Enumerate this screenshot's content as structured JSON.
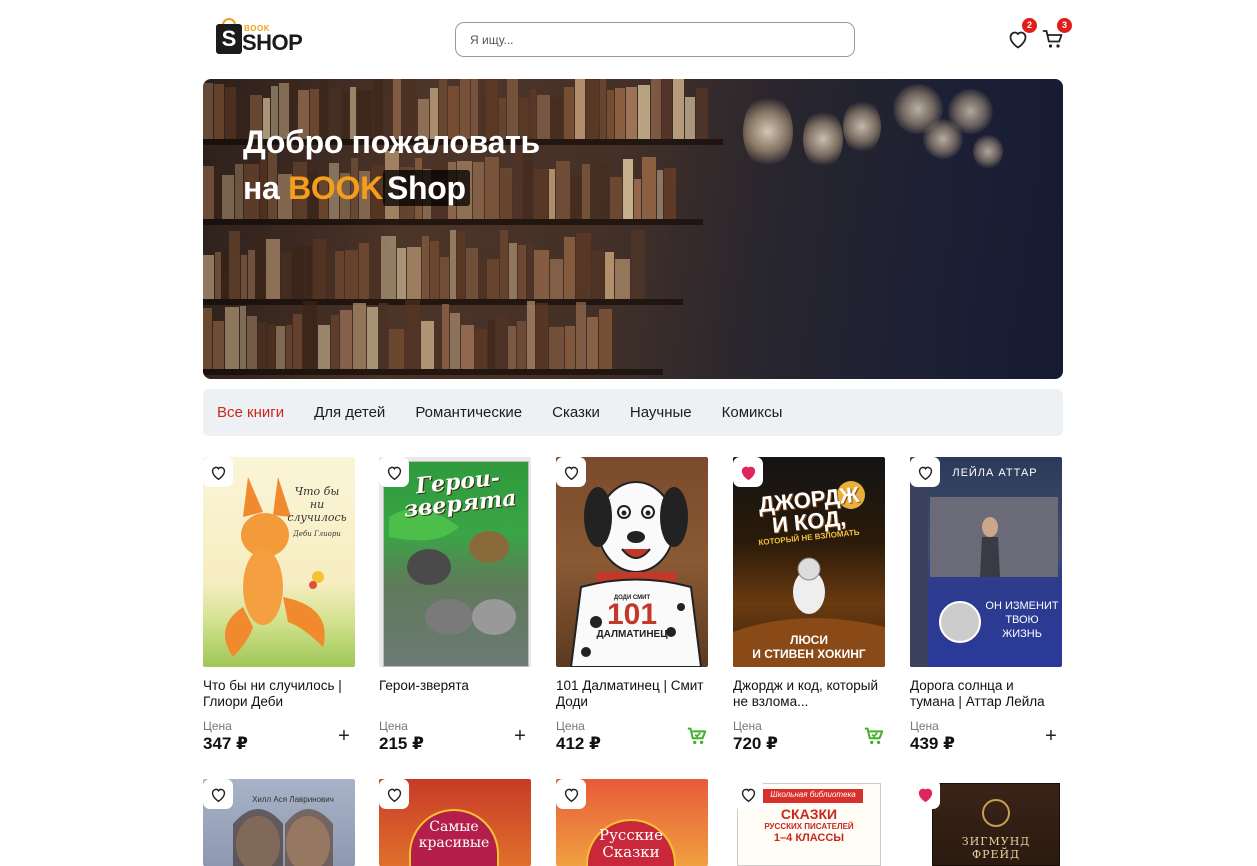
{
  "brand": {
    "book": "BOOK",
    "shop": "SHOP",
    "mark": "S"
  },
  "search": {
    "placeholder": "Я ищу...",
    "value": ""
  },
  "header": {
    "favorites_count": "2",
    "cart_count": "3"
  },
  "hero": {
    "line1": "Добро пожаловать",
    "line2_prefix": "на ",
    "line2_accent": "BOOK",
    "line2_shop": "Shop"
  },
  "categories": [
    {
      "label": "Все книги",
      "active": true
    },
    {
      "label": "Для детей",
      "active": false
    },
    {
      "label": "Романтические",
      "active": false
    },
    {
      "label": "Сказки",
      "active": false
    },
    {
      "label": "Научные",
      "active": false
    },
    {
      "label": "Комиксы",
      "active": false
    }
  ],
  "price_label": "Цена",
  "products": [
    {
      "title": "Что бы ни случилось | Глиори Деби",
      "price": "347 ₽",
      "favorite": false,
      "in_cart": false,
      "cover_text": [
        "Что бы",
        "ни",
        "случилось",
        "Деби Глиори"
      ]
    },
    {
      "title": "Герои-зверята",
      "price": "215 ₽",
      "favorite": false,
      "in_cart": false,
      "cover_text": [
        "Герои-",
        "зверята"
      ]
    },
    {
      "title": "101 Далматинец | Смит Доди",
      "price": "412 ₽",
      "favorite": false,
      "in_cart": true,
      "cover_text": [
        "ДОДИ СМИТ",
        "101",
        "ДАЛМАТИНЕЦ"
      ]
    },
    {
      "title": "Джордж и код, который не взлома...",
      "price": "720 ₽",
      "favorite": true,
      "in_cart": true,
      "cover_text": [
        "ДЖОРДЖ",
        "И КОД,",
        "КОТОРЫЙ НЕ ВЗЛОМАТЬ",
        "ЛЮСИ",
        "И СТИВЕН ХОКИНГ"
      ]
    },
    {
      "title": "Дорога солнца и тумана | Аттар Лейла",
      "price": "439 ₽",
      "favorite": false,
      "in_cart": false,
      "cover_text": [
        "ЛЕЙЛА АТТАР",
        "ОН ИЗМЕНИТ",
        "ТВОЮ",
        "ЖИЗНЬ"
      ]
    }
  ],
  "products_row2": [
    {
      "favorite": false,
      "cover_text": [
        "Хилл  Ася Лавринович"
      ]
    },
    {
      "favorite": false,
      "cover_text": [
        "Самые",
        "красивые"
      ]
    },
    {
      "favorite": false,
      "cover_text": [
        "Русские",
        "Сказки"
      ]
    },
    {
      "favorite": false,
      "cover_text": [
        "Школьная библиотека",
        "СКАЗКИ",
        "РУССКИХ ПИСАТЕЛЕЙ",
        "1–4 КЛАССЫ"
      ]
    },
    {
      "favorite": true,
      "cover_text": [
        "ЗИГМУНД",
        "ФРЕЙД"
      ]
    }
  ],
  "colors": {
    "accent_red": "#c8281e",
    "accent_orange": "#f59e1b",
    "favorite_active": "#e0245e",
    "cart_green": "#43b02a",
    "badge": "#e21b1b"
  }
}
